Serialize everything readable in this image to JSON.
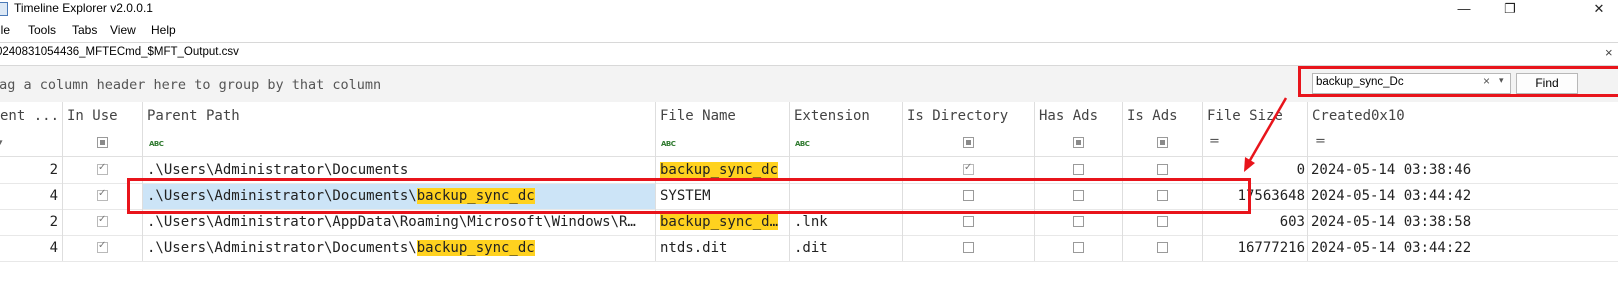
{
  "window": {
    "title": "Timeline Explorer v2.0.0.1",
    "minimize": "—",
    "maximize": "❐",
    "close": "✕"
  },
  "menu": [
    "ile",
    "Tools",
    "Tabs",
    "View",
    "Help"
  ],
  "tab": {
    "label": "0240831054436_MFTECmd_$MFT_Output.csv",
    "close": "×"
  },
  "group_hint": "rag a column header here to group by that column",
  "search": {
    "value": "backup_sync_Dc",
    "clear": "×",
    "dropdown": "▾",
    "find_label": "Find"
  },
  "columns": [
    "ent ...",
    "In Use",
    "Parent Path",
    "File Name",
    "Extension",
    "Is Directory",
    "Has Ads",
    "Is Ads",
    "File Size",
    "Created0x10"
  ],
  "filter": {
    "text_icon": "ABC",
    "eq": "="
  },
  "rows": [
    {
      "entry": "2",
      "in_use": true,
      "parent_pre": ".\\Users\\Administrator\\Documents",
      "parent_hl": "",
      "file_name": "backup_sync_dc",
      "file_name_hl": true,
      "extension": "",
      "is_dir": true,
      "has_ads": false,
      "is_ads": false,
      "file_size": "0",
      "created": "2024-05-14 03:38:46"
    },
    {
      "entry": "4",
      "in_use": true,
      "parent_pre": ".\\Users\\Administrator\\Documents\\",
      "parent_hl": "backup_sync_dc",
      "file_name": "SYSTEM",
      "file_name_hl": false,
      "extension": "",
      "is_dir": false,
      "has_ads": false,
      "is_ads": false,
      "file_size": "17563648",
      "created": "2024-05-14 03:44:42"
    },
    {
      "entry": "2",
      "in_use": true,
      "parent_pre": ".\\Users\\Administrator\\AppData\\Roaming\\Microsoft\\Windows\\R…",
      "parent_hl": "",
      "file_name": "backup_sync_d…",
      "file_name_hl": true,
      "extension": ".lnk",
      "is_dir": false,
      "has_ads": false,
      "is_ads": false,
      "file_size": "603",
      "created": "2024-05-14 03:38:58"
    },
    {
      "entry": "4",
      "in_use": true,
      "parent_pre": ".\\Users\\Administrator\\Documents\\",
      "parent_hl": "backup_sync_dc",
      "file_name": "ntds.dit",
      "file_name_hl": false,
      "extension": ".dit",
      "is_dir": false,
      "has_ads": false,
      "is_ads": false,
      "file_size": "16777216",
      "created": "2024-05-14 03:44:22"
    }
  ],
  "colors": {
    "highlight": "#ffd21f",
    "selection": "#cce4f7",
    "annotation": "#e8141b"
  }
}
